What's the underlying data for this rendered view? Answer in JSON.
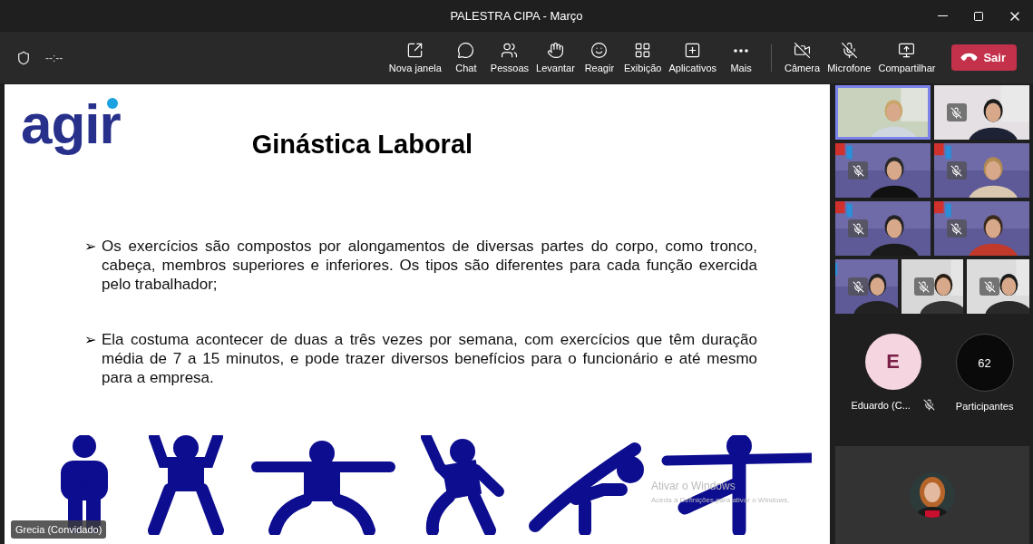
{
  "window": {
    "title": "PALESTRA CIPA - Março"
  },
  "toolbar": {
    "timer": "--:--",
    "buttons": [
      {
        "kind": "popout",
        "label": "Nova janela"
      },
      {
        "kind": "chat",
        "label": "Chat"
      },
      {
        "kind": "people",
        "label": "Pessoas"
      },
      {
        "kind": "hand",
        "label": "Levantar"
      },
      {
        "kind": "react",
        "label": "Reagir"
      },
      {
        "kind": "view",
        "label": "Exibição"
      },
      {
        "kind": "apps",
        "label": "Aplicativos"
      },
      {
        "kind": "more",
        "label": "Mais"
      }
    ],
    "devices": [
      {
        "kind": "camera",
        "label": "Câmera",
        "off": true
      },
      {
        "kind": "mic",
        "label": "Microfone",
        "off": true
      },
      {
        "kind": "share",
        "label": "Compartilhar"
      }
    ],
    "leave": {
      "label": "Sair"
    }
  },
  "slide": {
    "logo": "agir",
    "title": "Ginástica Laboral",
    "bullets": [
      {
        "marker": "➢",
        "text": "Os exercícios são compostos por alongamentos de diversas partes do corpo, como tronco, cabeça, membros superiores e inferiores. Os tipos são diferentes para cada função exercida pelo trabalhador;"
      },
      {
        "marker": "➢",
        "text": "Ela costuma acontecer de duas a três vezes por semana, com exercícios que têm duração média de 7 a 15 minutos, e pode trazer diversos benefícios para o funcionário e até mesmo para a empresa."
      }
    ],
    "activation": {
      "title": "Ativar o Windows",
      "hint": "Aceda a Definições para ativar o Windows."
    },
    "presenter": "Grecia (Convidado)"
  },
  "video_tiles": [
    {
      "selected": true,
      "muted": false
    },
    {
      "selected": false,
      "muted": true
    },
    {
      "selected": false,
      "muted": true
    },
    {
      "selected": false,
      "muted": true
    },
    {
      "selected": false,
      "muted": true
    },
    {
      "selected": false,
      "muted": true
    },
    {
      "selected": false,
      "muted": true
    },
    {
      "selected": false,
      "muted": true
    },
    {
      "selected": false,
      "muted": true
    }
  ],
  "avatar": {
    "initial": "E",
    "name": "Eduardo (C...",
    "muted": true
  },
  "participants": {
    "count": "62",
    "label": "Participantes"
  }
}
